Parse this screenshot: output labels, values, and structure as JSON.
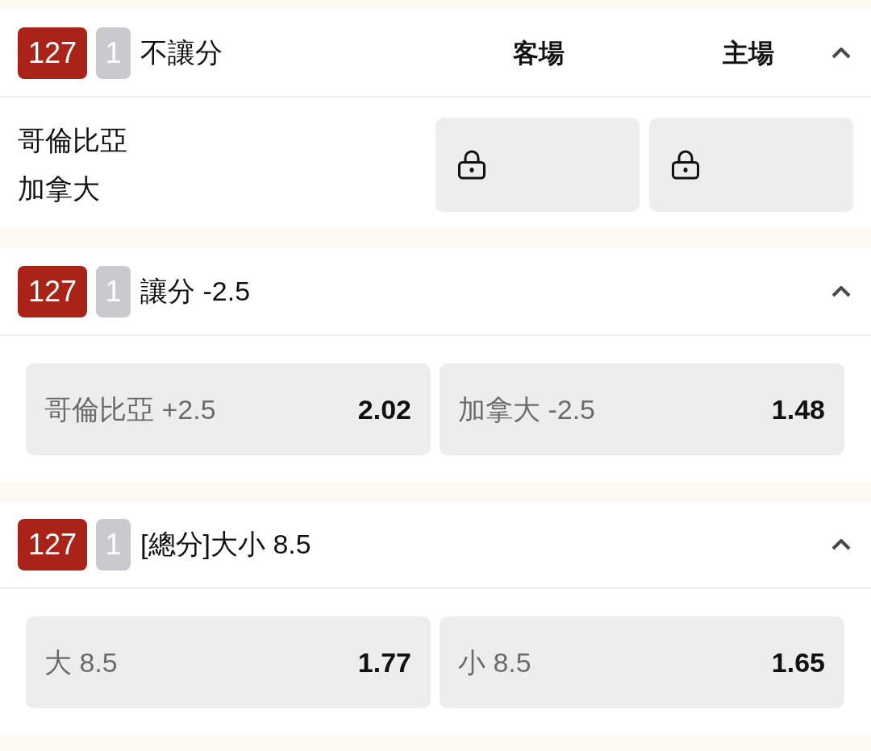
{
  "markets": [
    {
      "kind": "teams",
      "code": "127",
      "count": "1",
      "title": "不讓分",
      "expanded": true,
      "columns": [
        "客場",
        "主場"
      ],
      "teams": [
        "哥倫比亞",
        "加拿大"
      ],
      "selections": [
        {
          "locked": true
        },
        {
          "locked": true
        }
      ]
    },
    {
      "kind": "options",
      "code": "127",
      "count": "1",
      "title": "讓分 -2.5",
      "expanded": true,
      "selections": [
        {
          "label": "哥倫比亞 +2.5",
          "odds": "2.02"
        },
        {
          "label": "加拿大 -2.5",
          "odds": "1.48"
        }
      ]
    },
    {
      "kind": "options",
      "code": "127",
      "count": "1",
      "title": "[總分]大小 8.5",
      "expanded": true,
      "selections": [
        {
          "label": "大 8.5",
          "odds": "1.77"
        },
        {
          "label": "小 8.5",
          "odds": "1.65"
        }
      ]
    }
  ]
}
